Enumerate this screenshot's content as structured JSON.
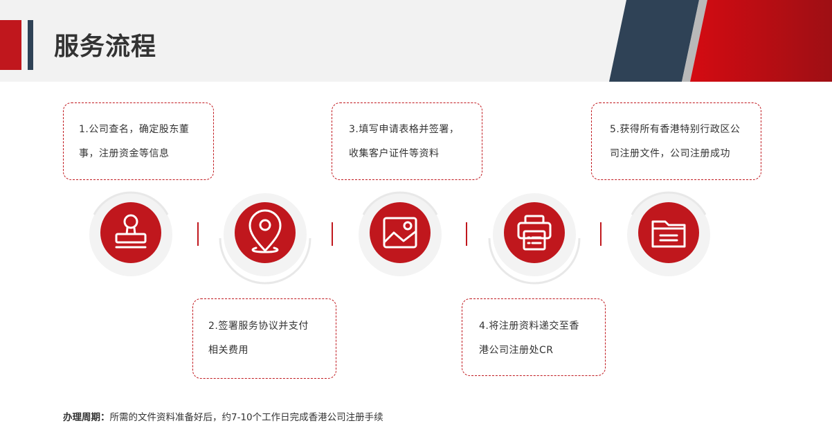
{
  "header": {
    "title": "服务流程"
  },
  "steps": {
    "s1": {
      "line1": "1.公司查名，确定股东董",
      "line2": "事，注册资金等信息",
      "icon": "stamp-icon"
    },
    "s2": {
      "line1": "2.签署服务协议并支付",
      "line2": "相关费用",
      "icon": "location-pin-icon"
    },
    "s3": {
      "line1": "3.填写申请表格并签署，",
      "line2": "收集客户证件等资料",
      "icon": "image-icon"
    },
    "s4": {
      "line1": "4.将注册资料递交至香",
      "line2": "港公司注册处CR",
      "icon": "printer-icon"
    },
    "s5": {
      "line1": "5.获得所有香港特别行政区公",
      "line2": "司注册文件，公司注册成功",
      "icon": "folder-icon"
    }
  },
  "footer": {
    "label": "办理周期：",
    "text": "所需的文件资料准备好后，约7-10个工作日完成香港公司注册手续"
  },
  "colors": {
    "accent": "#c0171d",
    "navy": "#2f4256",
    "header_bg": "#f2f2f2",
    "ring": "#ececec"
  }
}
